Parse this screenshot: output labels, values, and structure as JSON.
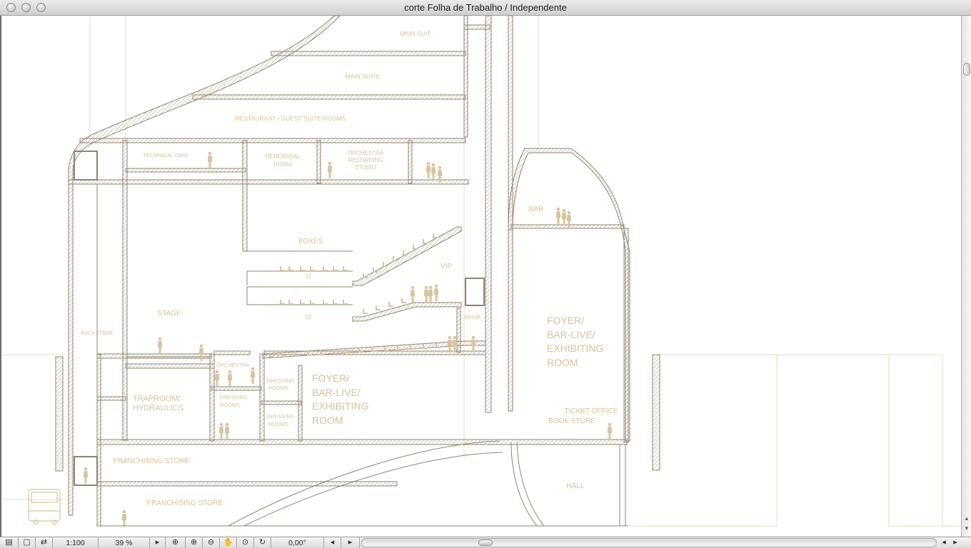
{
  "window": {
    "title": "corte Folha de Trabalho / Independente"
  },
  "drawing": {
    "rooms": {
      "main_suit_1": "MAIN SUIT",
      "main_suit_2": "MAIN SUITE",
      "restaurant": "RESTAURANT / GUEST SUITE ROOMS",
      "technical_grid": "TECHNICAL GRID",
      "rehearsal_l1": "REHEARSAL",
      "rehearsal_l2": "ROOM",
      "orchestra_rec_l1": "ORCHESTRA",
      "orchestra_rec_l2": "RECORDING",
      "orchestra_rec_l3": "STUDIO",
      "bar": "BAR",
      "boxes": "BOXES",
      "vip": "VIP",
      "row_12_a": "12",
      "row_12_b": "12",
      "stage": "STAGE",
      "backstage": "BACKSTAGE",
      "regie": "REGIE",
      "orchestra": "ORCHESTRA",
      "foyer_right_l1": "FOYER/",
      "foyer_right_l2": "BAR-LIVE/",
      "foyer_right_l3": "EXHIBITING",
      "foyer_right_l4": "ROOM",
      "foyer_center_l1": "FOYER/",
      "foyer_center_l2": "BAR-LIVE/",
      "foyer_center_l3": "EXHIBITING",
      "foyer_center_l4": "ROOM",
      "traproom_l1": "TRAPROOM/",
      "traproom_l2": "HYDRAULICS",
      "dressing_a_l1": "DRESSING",
      "dressing_a_l2": "ROOMS",
      "dressing_b_l1": "DRESSING",
      "dressing_b_l2": "ROOMS",
      "dressing_c_l1": "DRESSING",
      "dressing_c_l2": "ROOMS",
      "ticket_office": "TICKET OFFICE",
      "book_store": "BOOK STORE",
      "franchising_1": "FRANCHISING STORE",
      "franchising_2": "FRANCHISING STORE",
      "hall": "HALL"
    },
    "colors": {
      "wall": "#8f8373",
      "hatch": "#b9ab97",
      "label": "#d7bf9b",
      "figure": "#d9c4a0",
      "guide": "#e6dcc6"
    }
  },
  "statusbar": {
    "scale": "1:100",
    "zoom": "39 %",
    "angle": "0,00°",
    "icons": [
      "layers-icon",
      "preview-icon",
      "navigator-icon",
      "play-icon",
      "zoom-area-icon",
      "zoom-in-icon",
      "zoom-out-icon",
      "pan-hand-icon",
      "fit-window-icon",
      "rotate-icon",
      "zoom-previous-icon",
      "zoom-next-icon"
    ]
  }
}
